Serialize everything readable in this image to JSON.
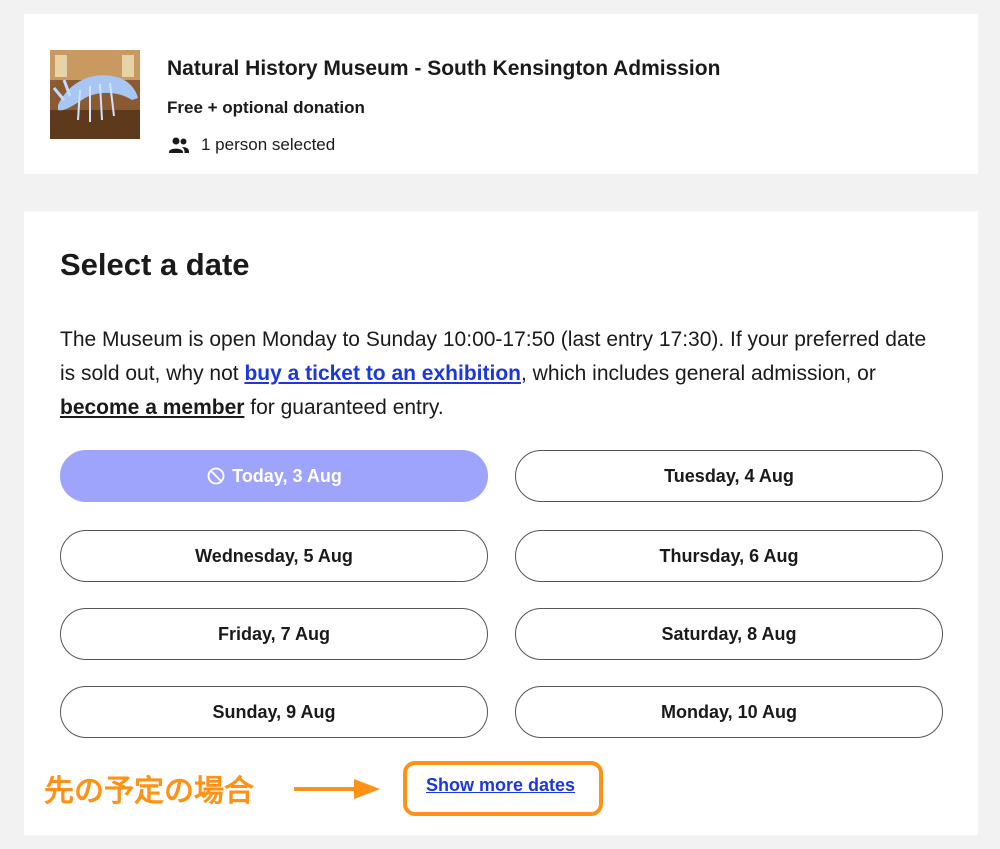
{
  "product": {
    "title": "Natural History Museum - South Kensington Admission",
    "price": "Free + optional donation",
    "people": "1 person selected",
    "people_icon": "people-icon",
    "thumbnail": "museum-whale-skeleton-image"
  },
  "select_date": {
    "heading": "Select a date",
    "desc_part1": "The Museum is open Monday to Sunday 10:00-17:50 (last entry 17:30). If your preferred date is sold out, why not ",
    "link_exhibition": "buy a ticket to an exhibition",
    "desc_part2": ", which includes general admission, or ",
    "link_member": "become a member",
    "desc_part3": " for guaranteed entry.",
    "dates": [
      {
        "label": "Today, 3 Aug",
        "disabled": true
      },
      {
        "label": "Tuesday, 4 Aug",
        "disabled": false
      },
      {
        "label": "Wednesday, 5 Aug",
        "disabled": false
      },
      {
        "label": "Thursday, 6 Aug",
        "disabled": false
      },
      {
        "label": "Friday, 7 Aug",
        "disabled": false
      },
      {
        "label": "Saturday, 8 Aug",
        "disabled": false
      },
      {
        "label": "Sunday, 9 Aug",
        "disabled": false
      },
      {
        "label": "Monday, 10 Aug",
        "disabled": false
      }
    ],
    "disabled_icon": "block-icon",
    "show_more": "Show more dates"
  },
  "annotation": {
    "text": "先の予定の場合",
    "color": "#ff9114"
  },
  "colors": {
    "accent_link": "#1a37e0",
    "disabled_button": "#9ea4fb",
    "highlight": "#ff9114"
  }
}
